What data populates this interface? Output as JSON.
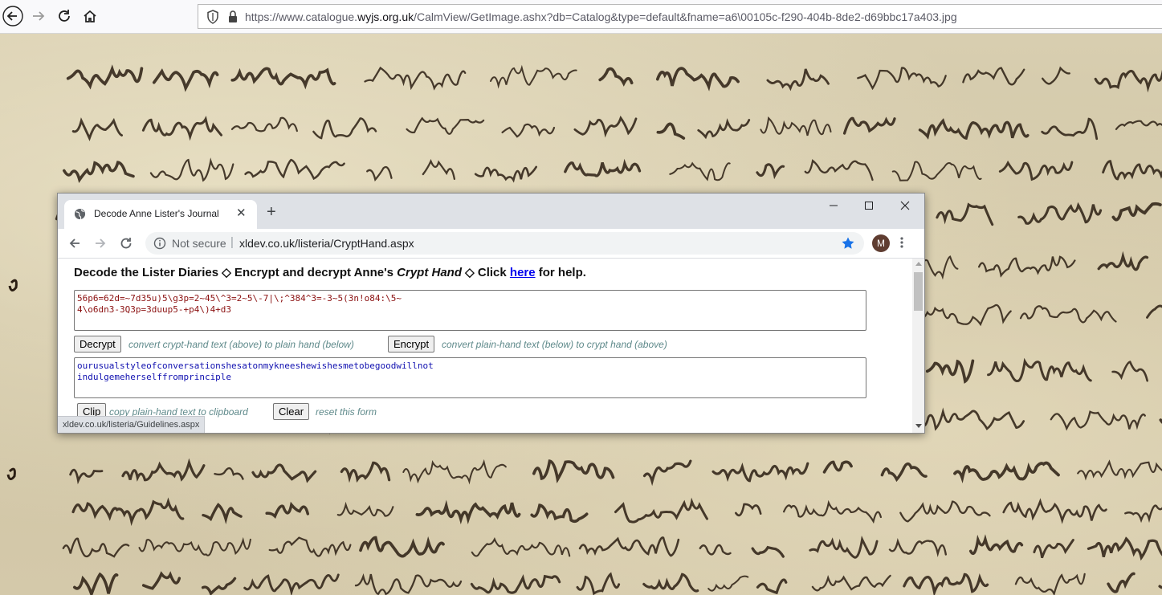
{
  "outer_browser": {
    "url_host_prefix": "https://www.catalogue.",
    "url_host_bold": "wyjs.org.uk",
    "url_path": "/CalmView/GetImage.ashx?db=Catalog&type=default&fname=a6\\00105c-f290-404b-8de2-d69bbc17a403.jpg"
  },
  "inner_browser": {
    "tab_title": "Decode Anne Lister's Journal",
    "security_label": "Not secure",
    "url": "xldev.co.uk/listeria/CryptHand.aspx",
    "avatar_letter": "M",
    "status_url": "xldev.co.uk/listeria/Guidelines.aspx",
    "star_color": "#1a73e8"
  },
  "page": {
    "heading_part1": "Decode the Lister Diaries ◇ Encrypt and decrypt Anne's ",
    "heading_italic": "Crypt Hand",
    "heading_part2": " ◇ Click ",
    "heading_link": "here",
    "heading_part3": " for help.",
    "crypt_text": "56p6=62d=~7d35u)5\\g3p=2~45\\^3=2~5\\-7|\\;^384^3=-3~5(3n!o84:\\5~\n4\\o6dn3-3Q3p=3duup5-+p4\\)4+d3",
    "plain_text": "ourusualstyleofconversationshesatonmykneeshewishesmetobegoodwillnot\nindulgemeherselffromprinciple",
    "decrypt_label": "Decrypt",
    "decrypt_hint": "convert crypt-hand text (above) to plain hand (below)",
    "encrypt_label": "Encrypt",
    "encrypt_hint": "convert plain-hand text (below) to crypt hand (above)",
    "clip_label": "Clip",
    "clip_hint": "copy plain-hand text to clipboard",
    "clear_label": "Clear",
    "clear_hint": "reset this form"
  }
}
